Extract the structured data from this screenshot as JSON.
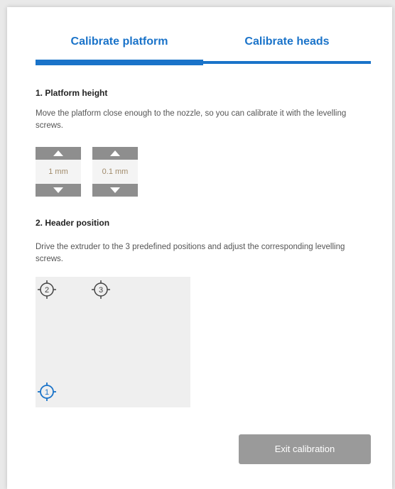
{
  "tabs": {
    "platform": "Calibrate platform",
    "heads": "Calibrate heads"
  },
  "section1": {
    "title": "1. Platform height",
    "text": "Move the platform close enough to the nozzle, so you can calibrate it with the levelling screws."
  },
  "steppers": [
    {
      "value": "1 mm"
    },
    {
      "value": "0.1 mm"
    }
  ],
  "section2": {
    "title": "2. Header position",
    "text": "Drive the extruder to the 3 predefined positions and adjust the corresponding levelling screws."
  },
  "markers": [
    {
      "label": "2",
      "color": "#444444"
    },
    {
      "label": "3",
      "color": "#444444"
    },
    {
      "label": "1",
      "color": "#1a73c9"
    }
  ],
  "exit_button": "Exit calibration",
  "colors": {
    "accent": "#1a73c9",
    "button_gray": "#9a9a9a"
  }
}
